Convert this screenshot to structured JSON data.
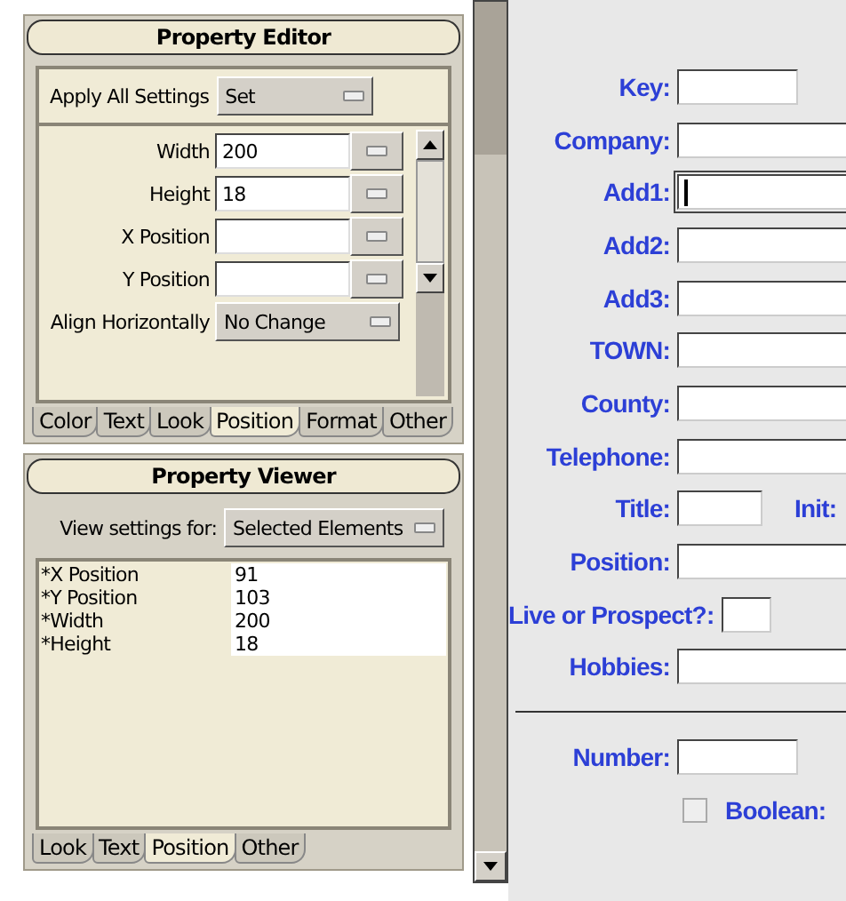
{
  "property_editor": {
    "title": "Property Editor",
    "apply_all": {
      "label": "Apply All Settings",
      "value": "Set"
    },
    "rows": [
      {
        "kind": "text",
        "label": "Width",
        "value": "200"
      },
      {
        "kind": "text",
        "label": "Height",
        "value": "18"
      },
      {
        "kind": "text",
        "label": "X Position",
        "value": ""
      },
      {
        "kind": "text",
        "label": "Y Position",
        "value": ""
      },
      {
        "kind": "select",
        "label": "Align Horizontally",
        "value": "No Change"
      }
    ],
    "tabs": [
      {
        "label": "Color",
        "selected": false
      },
      {
        "label": "Text",
        "selected": false
      },
      {
        "label": "Look",
        "selected": false
      },
      {
        "label": "Position",
        "selected": true
      },
      {
        "label": "Format",
        "selected": false
      },
      {
        "label": "Other",
        "selected": false
      }
    ]
  },
  "property_viewer": {
    "title": "Property Viewer",
    "view_label": "View settings for:",
    "view_value": "Selected Elements",
    "rows": [
      {
        "name": "*X Position",
        "value": "91"
      },
      {
        "name": "*Y Position",
        "value": "103"
      },
      {
        "name": "*Width",
        "value": "200"
      },
      {
        "name": "*Height",
        "value": "18"
      }
    ],
    "tabs": [
      {
        "label": "Look",
        "selected": false
      },
      {
        "label": "Text",
        "selected": false
      },
      {
        "label": "Position",
        "selected": true
      },
      {
        "label": "Other",
        "selected": false
      }
    ]
  },
  "form": {
    "fields": [
      {
        "kind": "short",
        "label": "Key:",
        "focused": false
      },
      {
        "kind": "wide",
        "label": "Company:",
        "focused": false
      },
      {
        "kind": "wide",
        "label": "Add1:",
        "focused": true
      },
      {
        "kind": "wide",
        "label": "Add2:",
        "focused": false
      },
      {
        "kind": "wide",
        "label": "Add3:",
        "focused": false
      },
      {
        "kind": "wide",
        "label": "TOWN:",
        "focused": false
      },
      {
        "kind": "wide",
        "label": "County:",
        "focused": false
      },
      {
        "kind": "wide",
        "label": "Telephone:",
        "focused": false
      },
      {
        "kind": "tiny",
        "label": "Title:",
        "focused": false,
        "extra_label": "Init:"
      },
      {
        "kind": "wide",
        "label": "Position:",
        "focused": false
      },
      {
        "kind": "box",
        "label": "Live or Prospect?:",
        "focused": false
      },
      {
        "kind": "wide",
        "label": "Hobbies:",
        "focused": false
      }
    ],
    "lower_fields": [
      {
        "kind": "short",
        "label": "Number:",
        "checked": false
      },
      {
        "kind": "check",
        "label": "Boolean:",
        "checked": false
      }
    ]
  }
}
